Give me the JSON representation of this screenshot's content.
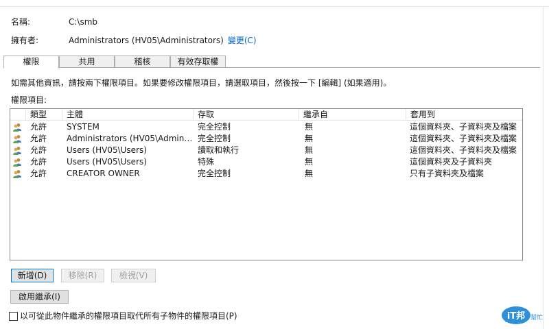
{
  "header": {
    "name_label": "名稱:",
    "name_value": "C:\\smb",
    "owner_label": "擁有者:",
    "owner_value": "Administrators (HV05\\Administrators)",
    "change_link": "變更(C)"
  },
  "tabs": [
    {
      "label": "權限",
      "active": true
    },
    {
      "label": "共用",
      "active": false
    },
    {
      "label": "稽核",
      "active": false
    },
    {
      "label": "有效存取權",
      "active": false
    }
  ],
  "description": "如需其他資訊，請按兩下權限項目。如果要修改權限項目，請選取項目，然後按一下 [編輯] (如果適用)。",
  "list_label": "權限項目:",
  "columns": [
    "類型",
    "主體",
    "存取",
    "繼承自",
    "套用到"
  ],
  "rows": [
    {
      "type": "允許",
      "principal": "SYSTEM",
      "access": "完全控制",
      "inherited": "無",
      "applies": "這個資料夾、子資料夾及檔案"
    },
    {
      "type": "允許",
      "principal": "Administrators (HV05\\Administrat...",
      "access": "完全控制",
      "inherited": "無",
      "applies": "這個資料夾、子資料夾及檔案"
    },
    {
      "type": "允許",
      "principal": "Users (HV05\\Users)",
      "access": "讀取和執行",
      "inherited": "無",
      "applies": "這個資料夾、子資料夾及檔案"
    },
    {
      "type": "允許",
      "principal": "Users (HV05\\Users)",
      "access": "特殊",
      "inherited": "無",
      "applies": "這個資料夾及子資料夾"
    },
    {
      "type": "允許",
      "principal": "CREATOR OWNER",
      "access": "完全控制",
      "inherited": "無",
      "applies": "只有子資料夾及檔案"
    }
  ],
  "buttons": {
    "add": "新增(D)",
    "remove": "移除(R)",
    "view": "檢視(V)",
    "enable_inheritance": "啟用繼承(I)"
  },
  "checkbox": {
    "label": "以可從此物件繼承的權限項目取代所有子物件的權限項目(P)",
    "checked": false
  },
  "watermark": {
    "brand": "iT邦",
    "sub": "幫忙"
  },
  "colors": {
    "link": "#0066cc",
    "accent": "#0078d7"
  },
  "icons": {
    "row_icon": "users-group-icon"
  }
}
